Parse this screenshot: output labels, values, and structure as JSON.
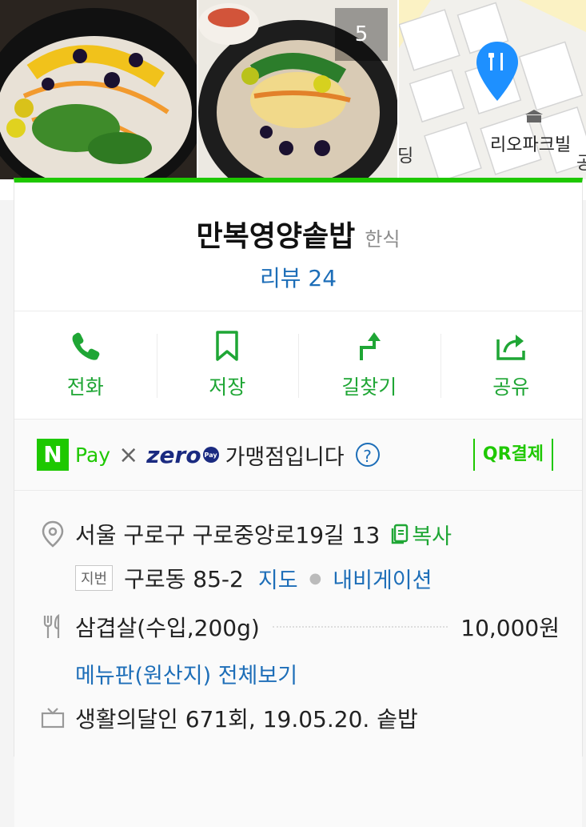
{
  "photos": {
    "count_badge": "5"
  },
  "map": {
    "poi_label": "리오파크빌",
    "edge_left": "딩",
    "edge_right": "공"
  },
  "place": {
    "name": "만복영양솥밥",
    "category": "한식",
    "reviews": "리뷰 24"
  },
  "actions": [
    {
      "label": "전화",
      "icon": "phone-icon"
    },
    {
      "label": "저장",
      "icon": "bookmark-icon"
    },
    {
      "label": "길찾기",
      "icon": "directions-icon"
    },
    {
      "label": "공유",
      "icon": "share-icon"
    }
  ],
  "pay": {
    "npay_letter": "N",
    "npay_word": "Pay",
    "times": "×",
    "zero_word": "zero",
    "zero_badge": "Pay",
    "text": "가맹점입니다",
    "help": "?",
    "qr_label": "QR결제"
  },
  "info": {
    "address": "서울 구로구 구로중앙로19길 13",
    "copy_label": "복사",
    "jibun_tag": "지번",
    "jibun_address": "구로동 85-2",
    "map_link": "지도",
    "nav_link": "내비게이션",
    "menu_item": "삼겹살(수입,200g)",
    "menu_price": "10,000원",
    "menu_all_link": "메뉴판(원산지) 전체보기",
    "tv_info": "생활의달인 671회, 19.05.20. 솥밥"
  },
  "colors": {
    "accent_green": "#1ec800",
    "action_green": "#1fa635",
    "link_blue": "#1d6eb8",
    "map_pin": "#1e90ff"
  }
}
